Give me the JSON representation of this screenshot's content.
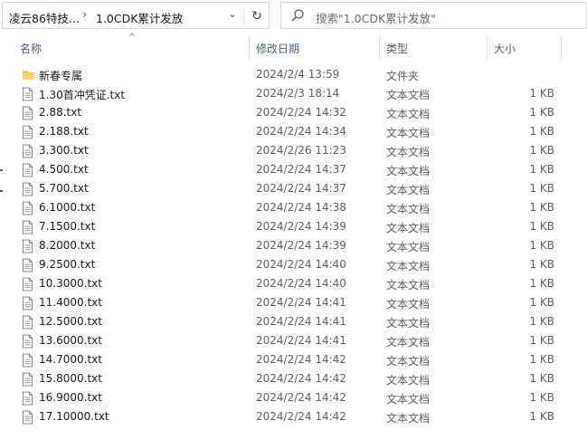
{
  "address_bar": {
    "crumbs": [
      "凌云86特技...",
      "1.0CDK累计发放"
    ]
  },
  "search": {
    "placeholder": "搜索\"1.0CDK累计发放\""
  },
  "columns": {
    "name": "名称",
    "date": "修改日期",
    "type": "类型",
    "size": "大小"
  },
  "files": [
    {
      "name": "新春专属",
      "date": "2024/2/4 13:59",
      "type": "文件夹",
      "size": "",
      "icon": "folder"
    },
    {
      "name": "1.30首冲凭证.txt",
      "date": "2024/2/3 18:14",
      "type": "文本文档",
      "size": "1 KB",
      "icon": "text-file"
    },
    {
      "name": "2.88.txt",
      "date": "2024/2/24 14:32",
      "type": "文本文档",
      "size": "1 KB",
      "icon": "text-file"
    },
    {
      "name": "2.188.txt",
      "date": "2024/2/24 14:34",
      "type": "文本文档",
      "size": "1 KB",
      "icon": "text-file"
    },
    {
      "name": "3.300.txt",
      "date": "2024/2/26 11:23",
      "type": "文本文档",
      "size": "1 KB",
      "icon": "text-file"
    },
    {
      "name": "4.500.txt",
      "date": "2024/2/24 14:37",
      "type": "文本文档",
      "size": "1 KB",
      "icon": "text-file"
    },
    {
      "name": "5.700.txt",
      "date": "2024/2/24 14:37",
      "type": "文本文档",
      "size": "1 KB",
      "icon": "text-file"
    },
    {
      "name": "6.1000.txt",
      "date": "2024/2/24 14:38",
      "type": "文本文档",
      "size": "1 KB",
      "icon": "text-file"
    },
    {
      "name": "7.1500.txt",
      "date": "2024/2/24 14:39",
      "type": "文本文档",
      "size": "1 KB",
      "icon": "text-file"
    },
    {
      "name": "8.2000.txt",
      "date": "2024/2/24 14:39",
      "type": "文本文档",
      "size": "1 KB",
      "icon": "text-file"
    },
    {
      "name": "9.2500.txt",
      "date": "2024/2/24 14:40",
      "type": "文本文档",
      "size": "1 KB",
      "icon": "text-file"
    },
    {
      "name": "10.3000.txt",
      "date": "2024/2/24 14:40",
      "type": "文本文档",
      "size": "1 KB",
      "icon": "text-file"
    },
    {
      "name": "11.4000.txt",
      "date": "2024/2/24 14:41",
      "type": "文本文档",
      "size": "1 KB",
      "icon": "text-file"
    },
    {
      "name": "12.5000.txt",
      "date": "2024/2/24 14:41",
      "type": "文本文档",
      "size": "1 KB",
      "icon": "text-file"
    },
    {
      "name": "13.6000.txt",
      "date": "2024/2/24 14:41",
      "type": "文本文档",
      "size": "1 KB",
      "icon": "text-file"
    },
    {
      "name": "14.7000.txt",
      "date": "2024/2/24 14:42",
      "type": "文本文档",
      "size": "1 KB",
      "icon": "text-file"
    },
    {
      "name": "15.8000.txt",
      "date": "2024/2/24 14:42",
      "type": "文本文档",
      "size": "1 KB",
      "icon": "text-file"
    },
    {
      "name": "16.9000.txt",
      "date": "2024/2/24 14:42",
      "type": "文本文档",
      "size": "1 KB",
      "icon": "text-file"
    },
    {
      "name": "17.10000.txt",
      "date": "2024/2/24 14:42",
      "type": "文本文档",
      "size": "1 KB",
      "icon": "text-file"
    }
  ],
  "colors": {
    "header_text": "#4c607a",
    "folder": "#f3c24b",
    "meta_text": "#5f5f5f"
  }
}
